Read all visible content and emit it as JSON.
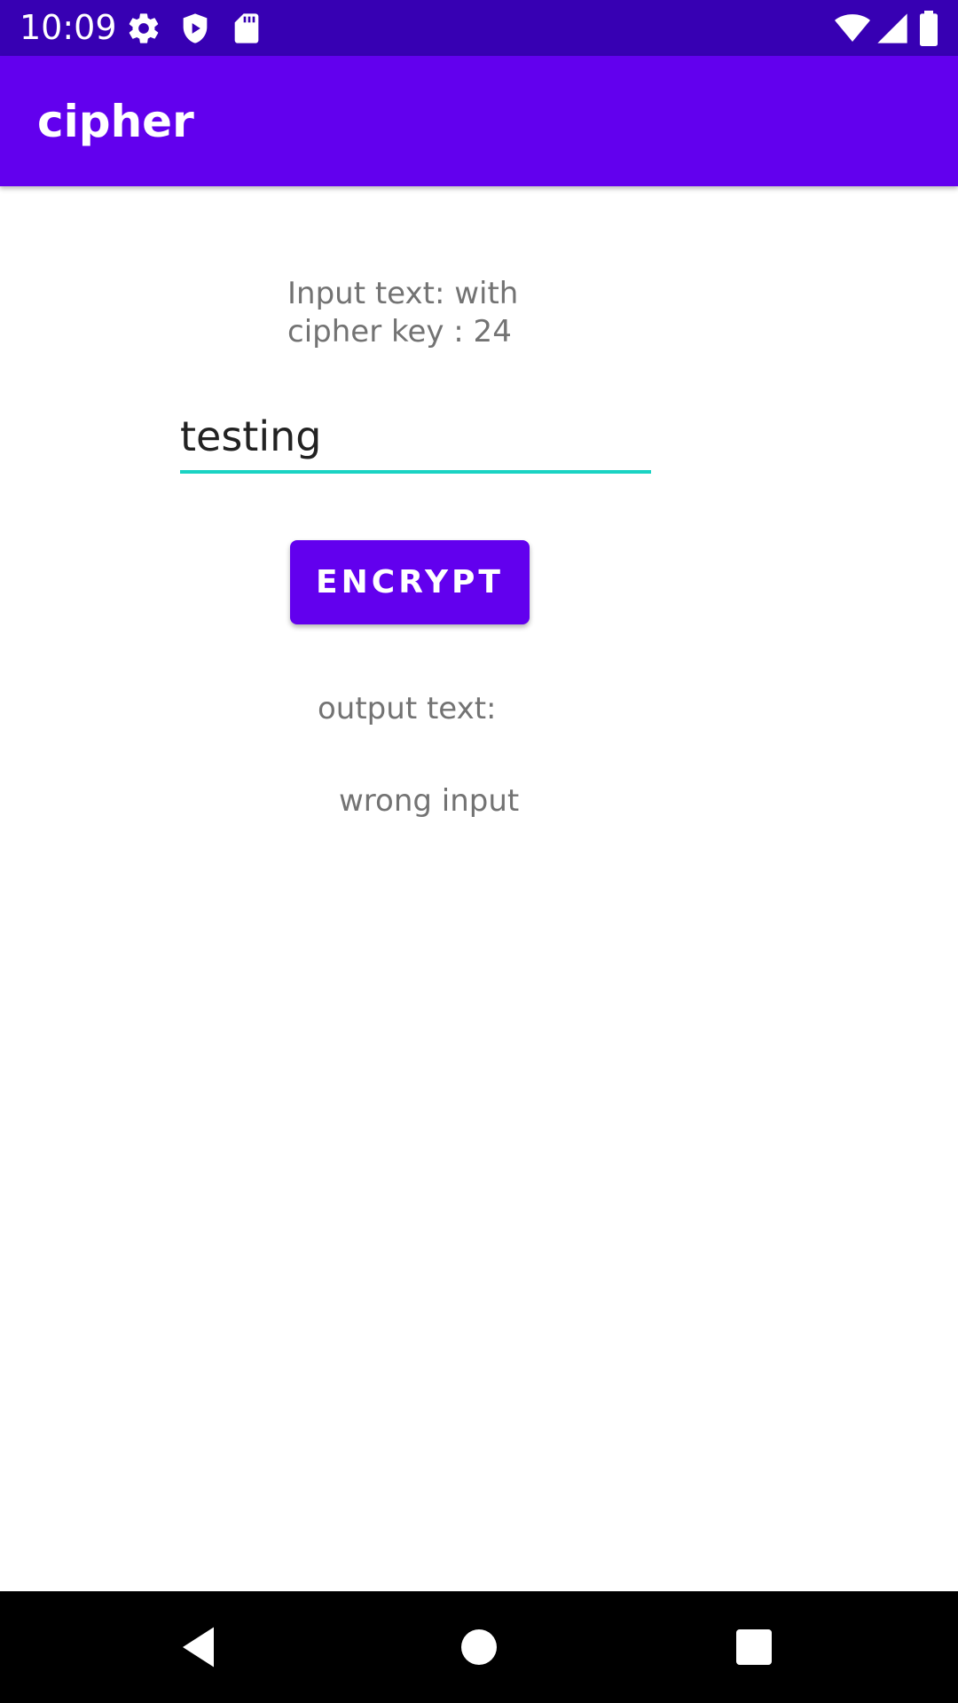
{
  "status_bar": {
    "time": "10:09",
    "left_icons": [
      "gear-icon",
      "shield-icon",
      "sd-card-icon"
    ],
    "right_icons": [
      "wifi-icon",
      "cell-signal-icon",
      "battery-icon"
    ]
  },
  "app_bar": {
    "title": "cipher"
  },
  "main": {
    "input_label": "Input text: with cipher key : 24",
    "input_value": "testing",
    "encrypt_label": "ENCRYPT",
    "output_label": "output text:",
    "output_value": "wrong input"
  },
  "nav_bar": {
    "buttons": [
      "back-icon",
      "home-icon",
      "recents-icon"
    ]
  },
  "colors": {
    "status_bar": "#3700b3",
    "primary": "#6200ee",
    "accent": "#1ad3c3",
    "secondary_text": "#737373"
  }
}
